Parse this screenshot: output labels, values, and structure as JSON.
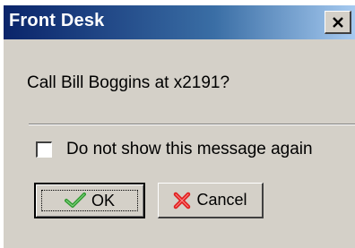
{
  "window": {
    "title": "Front Desk",
    "close_icon": "close-icon"
  },
  "message": {
    "text": "Call Bill Boggins at x2191?"
  },
  "option": {
    "label": "Do not show this message again",
    "checked": false
  },
  "buttons": {
    "ok_label": "OK",
    "ok_icon": "checkmark-icon",
    "ok_icon_color": "#2e9a2e",
    "cancel_label": "Cancel",
    "cancel_icon": "red-x-icon",
    "cancel_icon_color": "#e02020"
  },
  "colors": {
    "titlebar_start": "#0a246a",
    "titlebar_end": "#a6caf0",
    "dialog_bg": "#d4d0c8"
  }
}
